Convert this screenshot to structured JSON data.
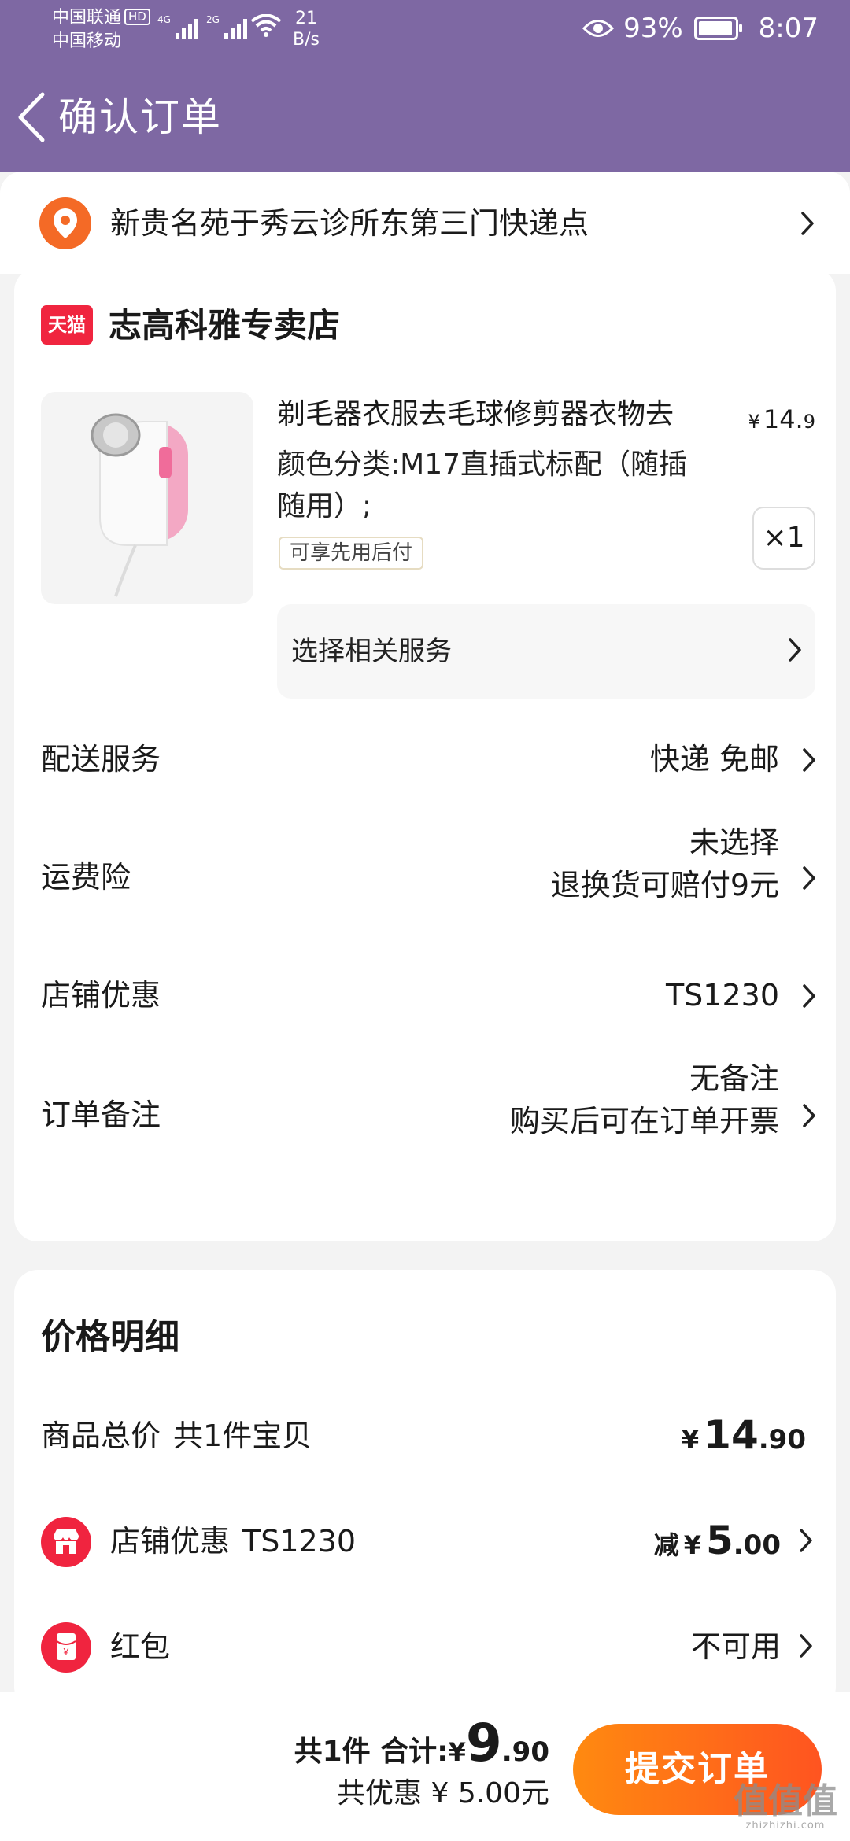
{
  "status_bar": {
    "carrier_1": "中国联通",
    "hd_badge": "HD",
    "carrier_2": "中国移动",
    "network_1": "4G",
    "network_2": "2G",
    "net_speed_value": "21",
    "net_speed_unit": "B/s",
    "battery_percent": "93%",
    "time": "8:07"
  },
  "nav": {
    "title": "确认订单"
  },
  "address": {
    "text": "新贵名苑于秀云诊所东第三门快递点"
  },
  "store": {
    "badge": "天猫",
    "name": "志高科雅专卖店",
    "product": {
      "title": "剃毛器衣服去毛球修剪器衣物去",
      "price_symbol": "¥",
      "price_int": "14.",
      "price_dec": "9",
      "spec_line_1": "颜色分类:M17直插式标配（随插",
      "spec_line_2": "随用）;",
      "tag": "可享先用后付",
      "quantity": "×1"
    },
    "service_label": "选择相关服务",
    "rows": {
      "delivery": {
        "label": "配送服务",
        "value": "快递 免邮"
      },
      "insurance": {
        "label": "运费险",
        "value_line_1": "未选择",
        "value_line_2": "退换货可赔付9元"
      },
      "coupon": {
        "label": "店铺优惠",
        "value": "TS1230"
      },
      "note": {
        "label": "订单备注",
        "value_line_1": "无备注",
        "value_line_2": "购买后可在订单开票"
      }
    }
  },
  "price_detail": {
    "heading": "价格明细",
    "subtotal": {
      "label": "商品总价",
      "count": "共1件宝贝",
      "symbol": "¥",
      "int": "14",
      "dec": ".90"
    },
    "store_coupon": {
      "label": "店铺优惠",
      "code": "TS1230",
      "prefix": "减",
      "symbol": "¥",
      "int": "5",
      "dec": ".00"
    },
    "red_packet": {
      "label": "红包",
      "value": "不可用"
    }
  },
  "bottom_bar": {
    "total_prefix": "共1件 合计:",
    "symbol": "¥",
    "total_int": "9",
    "total_dec": ".90",
    "discount_text": "共优惠 ¥ 5.00元",
    "submit_label": "提交订单"
  },
  "watermark": {
    "mark": "值值值",
    "domain": "zhizhizhi.com"
  },
  "colors": {
    "header_purple": "#7e68a3",
    "accent_orange": "#ff6a1a",
    "tmall_red": "#f0253f",
    "location_orange": "#f46a26"
  }
}
